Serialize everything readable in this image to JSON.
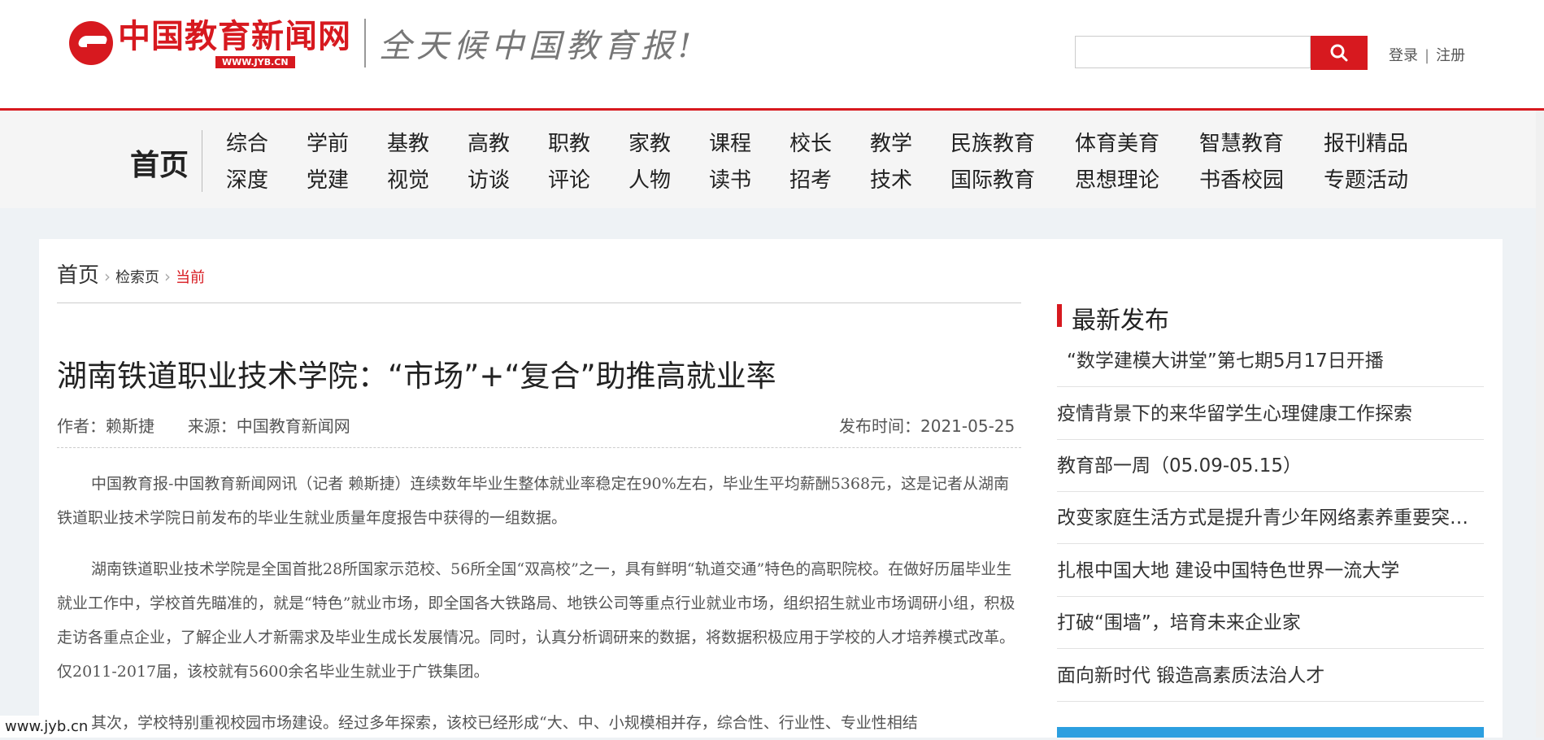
{
  "header": {
    "logo_text": "中国教育新闻网",
    "logo_url": "WWW.JYB.CN",
    "slogan": "全天候中国教育报!",
    "search": {
      "placeholder": "",
      "button_icon": "search-icon"
    },
    "login": "登录",
    "separator": "|",
    "register": "注册"
  },
  "nav": {
    "home": "首页",
    "row1": [
      "综合",
      "学前",
      "基教",
      "高教",
      "职教",
      "家教",
      "课程",
      "校长",
      "教学",
      "民族教育",
      "体育美育",
      "智慧教育",
      "报刊精品"
    ],
    "row2": [
      "深度",
      "党建",
      "视觉",
      "访谈",
      "评论",
      "人物",
      "读书",
      "招考",
      "技术",
      "国际教育",
      "思想理论",
      "书香校园",
      "专题活动"
    ]
  },
  "breadcrumb": {
    "home": "首页",
    "search": "检索页",
    "current": "当前"
  },
  "article": {
    "title": "湖南铁道职业技术学院：“市场”+“复合”助推高就业率",
    "author": "作者：赖斯捷",
    "source": "来源：中国教育新闻网",
    "date": "发布时间：2021-05-25",
    "paragraphs": [
      "中国教育报-中国教育新闻网讯（记者 赖斯捷）连续数年毕业生整体就业率稳定在90%左右，毕业生平均薪酬5368元，这是记者从湖南铁道职业技术学院日前发布的毕业生就业质量年度报告中获得的一组数据。",
      "湖南铁道职业技术学院是全国首批28所国家示范校、56所全国“双高校”之一，具有鲜明“轨道交通”特色的高职院校。在做好历届毕业生就业工作中，学校首先瞄准的，就是“特色”就业市场，即全国各大铁路局、地铁公司等重点行业就业市场，组织招生就业市场调研小组，积极走访各重点企业，了解企业人才新需求及毕业生成长发展情况。同时，认真分析调研来的数据，将数据积极应用于学校的人才培养模式改革。仅2011-2017届，该校就有5600余名毕业生就业于广铁集团。",
      "其次，学校特别重视校园市场建设。经过多年探索，该校已经形成“大、中、小规模相并存，综合性、行业性、专业性相结"
    ]
  },
  "sidebar": {
    "title": "最新发布",
    "items": [
      "“数学建模大讲堂”第七期5月17日开播",
      "疫情背景下的来华留学生心理健康工作探索",
      "教育部一周（05.09-05.15）",
      "改变家庭生活方式是提升青少年网络素养重要突破口",
      "扎根中国大地 建设中国特色世界一流大学",
      "打破“围墙”，培育未来企业家",
      "面向新时代 锻造高素质法治人才"
    ]
  },
  "watermark": "www.jyb.cn",
  "colors": {
    "brand_red": "#d7191f",
    "page_bg": "#eef2f5",
    "nav_bg": "#f5f5f5"
  }
}
